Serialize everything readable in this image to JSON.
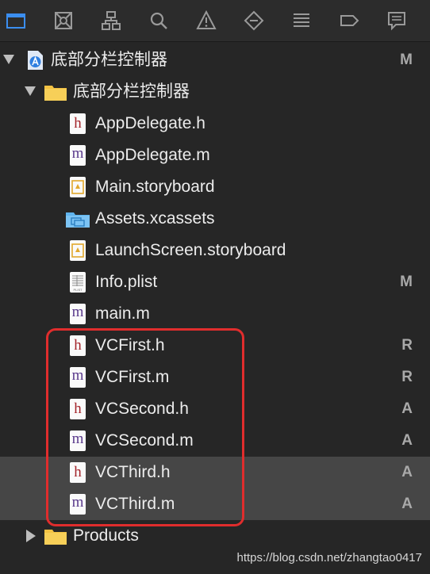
{
  "toolbar": {
    "icons": [
      "folder-icon",
      "source-control-icon",
      "hierarchy-icon",
      "search-icon",
      "warning-icon",
      "test-icon",
      "debug-icon",
      "breakpoint-icon",
      "report-icon"
    ]
  },
  "tree": {
    "project": {
      "label": "底部分栏控制器",
      "badge": "M"
    },
    "group": {
      "label": "底部分栏控制器"
    },
    "files": [
      {
        "label": "AppDelegate.h",
        "kind": "h",
        "badge": ""
      },
      {
        "label": "AppDelegate.m",
        "kind": "m",
        "badge": ""
      },
      {
        "label": "Main.storyboard",
        "kind": "storyboard",
        "badge": ""
      },
      {
        "label": "Assets.xcassets",
        "kind": "assets",
        "badge": ""
      },
      {
        "label": "LaunchScreen.storyboard",
        "kind": "storyboard",
        "badge": ""
      },
      {
        "label": "Info.plist",
        "kind": "plist",
        "badge": "M"
      },
      {
        "label": "main.m",
        "kind": "m",
        "badge": ""
      },
      {
        "label": "VCFirst.h",
        "kind": "h",
        "badge": "R"
      },
      {
        "label": "VCFirst.m",
        "kind": "m",
        "badge": "R"
      },
      {
        "label": "VCSecond.h",
        "kind": "h",
        "badge": "A"
      },
      {
        "label": "VCSecond.m",
        "kind": "m",
        "badge": "A"
      },
      {
        "label": "VCThird.h",
        "kind": "h",
        "badge": "A"
      },
      {
        "label": "VCThird.m",
        "kind": "m",
        "badge": "A"
      }
    ],
    "products": {
      "label": "Products"
    }
  },
  "icon_letters": {
    "h": "h",
    "m": "m",
    "plist": "PLIST"
  },
  "watermark": "https://blog.csdn.net/zhangtao0417"
}
